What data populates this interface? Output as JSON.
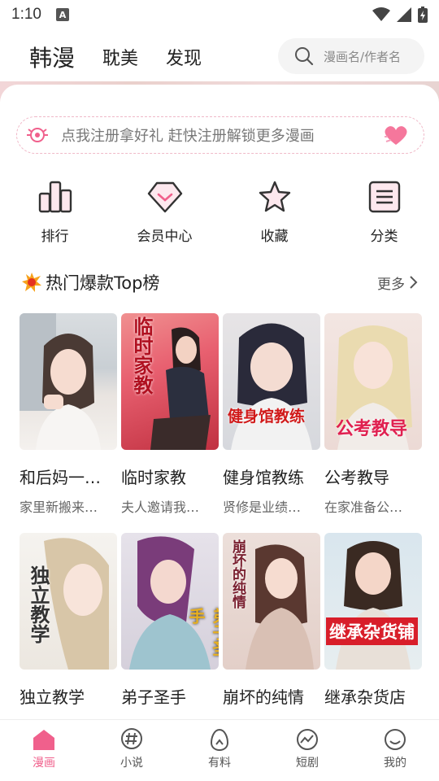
{
  "status_bar": {
    "time": "1:10",
    "notification_badge": "A"
  },
  "top_nav": {
    "tabs": [
      {
        "label": "韩漫",
        "active": true
      },
      {
        "label": "耽美",
        "active": false
      },
      {
        "label": "发现",
        "active": false
      }
    ],
    "search_placeholder": "漫画名/作者名"
  },
  "register_banner": {
    "text": "点我注册拿好礼 赶快注册解锁更多漫画"
  },
  "quick_links": [
    {
      "label": "排行",
      "icon": "ranking-icon"
    },
    {
      "label": "会员中心",
      "icon": "diamond-icon"
    },
    {
      "label": "收藏",
      "icon": "star-icon"
    },
    {
      "label": "分类",
      "icon": "list-icon"
    }
  ],
  "hot_section": {
    "title": "热门爆款Top榜",
    "more_label": "更多"
  },
  "comics": [
    {
      "name": "和后妈一…",
      "desc": "家里新搬来…",
      "cover_text": ""
    },
    {
      "name": "临时家教",
      "desc": "夫人邀请我…",
      "cover_text": "临时家教"
    },
    {
      "name": "健身馆教练",
      "desc": "贤修是业绩…",
      "cover_text": "健身馆教练"
    },
    {
      "name": "公考教导",
      "desc": "在家准备公…",
      "cover_text": "公考教导"
    },
    {
      "name": "独立教学",
      "desc": "",
      "cover_text": "独立教学"
    },
    {
      "name": "弟子圣手",
      "desc": "",
      "cover_text": "弟子圣手"
    },
    {
      "name": "崩坏的纯情",
      "desc": "",
      "cover_text": "崩坏的纯情"
    },
    {
      "name": "继承杂货店",
      "desc": "",
      "cover_text": "继承杂货铺"
    }
  ],
  "bottom_nav": [
    {
      "label": "漫画",
      "active": true
    },
    {
      "label": "小说",
      "active": false
    },
    {
      "label": "有料",
      "active": false
    },
    {
      "label": "短剧",
      "active": false
    },
    {
      "label": "我的",
      "active": false
    }
  ],
  "colors": {
    "accent": "#f0608c",
    "coral": "#f5779c"
  }
}
